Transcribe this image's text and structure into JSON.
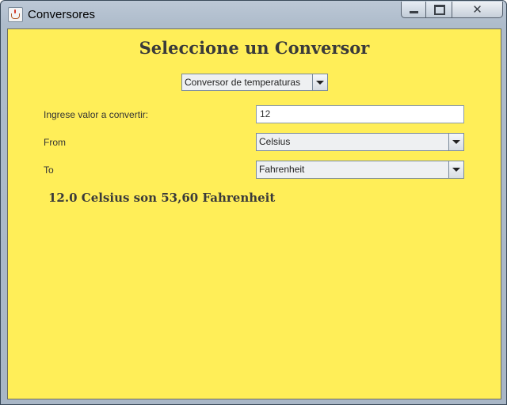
{
  "window": {
    "title": "Conversores"
  },
  "title_controls": {
    "minimize_icon": "minimize-icon",
    "maximize_icon": "maximize-icon",
    "close_glyph": "✕"
  },
  "main": {
    "heading": "Seleccione un Conversor",
    "converter_select": {
      "selected": "Conversor de temperaturas"
    },
    "value_label": "Ingrese valor a convertir:",
    "value_input": "12",
    "from_label": "From",
    "from_select": {
      "selected": "Celsius"
    },
    "to_label": "To",
    "to_select": {
      "selected": "Fahrenheit"
    },
    "result": "12.0 Celsius son 53,60 Fahrenheit"
  },
  "colors": {
    "content_background": "#ffee58",
    "heading_text": "#3a3a3a"
  }
}
